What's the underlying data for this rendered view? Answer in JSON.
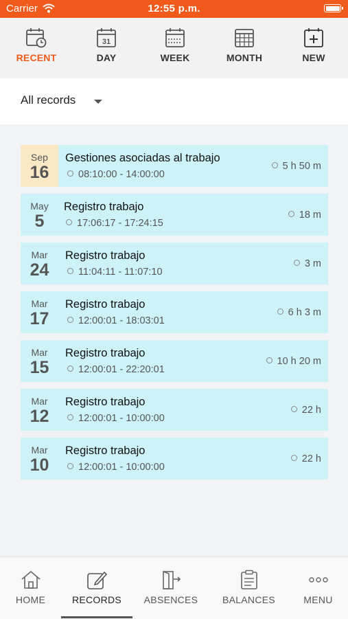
{
  "status_bar": {
    "carrier": "Carrier",
    "time": "12:55 p.m."
  },
  "top_tabs": [
    {
      "label": "RECENT",
      "icon": "calendar-clock-icon",
      "active": true
    },
    {
      "label": "DAY",
      "icon": "calendar-31-icon",
      "active": false
    },
    {
      "label": "WEEK",
      "icon": "calendar-week-icon",
      "active": false
    },
    {
      "label": "MONTH",
      "icon": "calendar-grid-icon",
      "active": false
    },
    {
      "label": "NEW",
      "icon": "calendar-plus-icon",
      "active": false
    }
  ],
  "filter": {
    "selected": "All records"
  },
  "records": [
    {
      "month": "Sep",
      "day": "16",
      "title": "Gestiones asociadas al trabajo",
      "times": "08:10:00 - 14:00:00",
      "duration": "5 h 50 m",
      "highlight": true
    },
    {
      "month": "May",
      "day": "5",
      "title": "Registro trabajo",
      "times": "17:06:17 - 17:24:15",
      "duration": "18 m",
      "highlight": false
    },
    {
      "month": "Mar",
      "day": "24",
      "title": "Registro trabajo",
      "times": "11:04:11 - 11:07:10",
      "duration": "3 m",
      "highlight": false
    },
    {
      "month": "Mar",
      "day": "17",
      "title": "Registro trabajo",
      "times": "12:00:01 - 18:03:01",
      "duration": "6 h 3 m",
      "highlight": false
    },
    {
      "month": "Mar",
      "day": "15",
      "title": "Registro trabajo",
      "times": "12:00:01 - 22:20:01",
      "duration": "10 h 20 m",
      "highlight": false
    },
    {
      "month": "Mar",
      "day": "12",
      "title": "Registro trabajo",
      "times": "12:00:01 - 10:00:00",
      "duration": "22 h",
      "highlight": false
    },
    {
      "month": "Mar",
      "day": "10",
      "title": "Registro trabajo",
      "times": "12:00:01 - 10:00:00",
      "duration": "22 h",
      "highlight": false
    }
  ],
  "bottom_tabs": [
    {
      "label": "HOME",
      "icon": "home-icon",
      "active": false
    },
    {
      "label": "RECORDS",
      "icon": "edit-note-icon",
      "active": true
    },
    {
      "label": "ABSENCES",
      "icon": "door-exit-icon",
      "active": false
    },
    {
      "label": "BALANCES",
      "icon": "clipboard-list-icon",
      "active": false
    },
    {
      "label": "MENU",
      "icon": "more-dots-icon",
      "active": false
    }
  ],
  "colors": {
    "accent": "#f05a1a",
    "record_bg": "#cdf3f9",
    "date_highlight": "#fbe9c6"
  }
}
